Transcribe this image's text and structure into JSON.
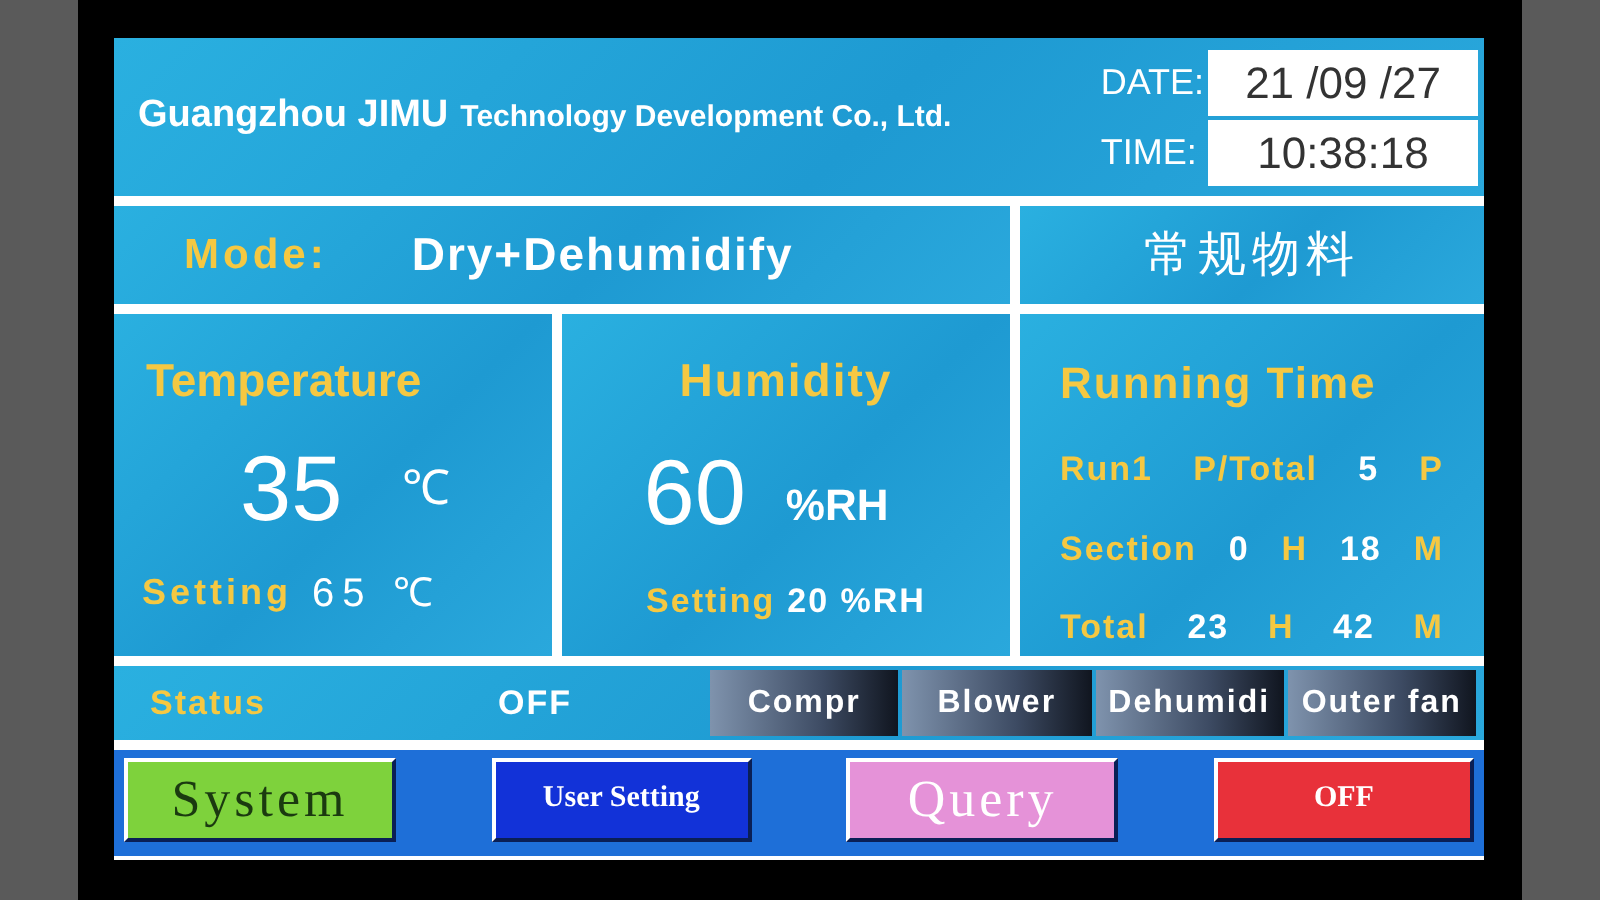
{
  "header": {
    "company_bold": "Guangzhou JIMU",
    "company_rest": "Technology Development Co., Ltd.",
    "date_label": "DATE:",
    "date": "21 /09 /27",
    "time_label": "TIME:",
    "time": "10:38:18"
  },
  "mode": {
    "label": "Mode:",
    "value": "Dry+Dehumidify",
    "material": "常规物料"
  },
  "temperature": {
    "title": "Temperature",
    "value": "35",
    "unit": "℃",
    "setting_label": "Setting",
    "setting_value": "65",
    "setting_unit": "℃"
  },
  "humidity": {
    "title": "Humidity",
    "value": "60",
    "unit": "%RH",
    "setting_label": "Setting",
    "setting_value": "20 %RH"
  },
  "running_time": {
    "title": "Running Time",
    "rows": [
      {
        "parts": [
          {
            "text": "Run1",
            "kind": "label"
          },
          {
            "text": "P/Total",
            "kind": "label"
          },
          {
            "text": "5",
            "kind": "value"
          },
          {
            "text": "P",
            "kind": "label"
          }
        ]
      },
      {
        "parts": [
          {
            "text": "Section",
            "kind": "label"
          },
          {
            "text": "0",
            "kind": "value"
          },
          {
            "text": "H",
            "kind": "label"
          },
          {
            "text": "18",
            "kind": "value"
          },
          {
            "text": "M",
            "kind": "label"
          }
        ]
      },
      {
        "parts": [
          {
            "text": "Total",
            "kind": "label"
          },
          {
            "text": "23",
            "kind": "value"
          },
          {
            "text": "H",
            "kind": "label"
          },
          {
            "text": "42",
            "kind": "value"
          },
          {
            "text": "M",
            "kind": "label"
          }
        ]
      }
    ]
  },
  "status": {
    "label": "Status",
    "value": "OFF",
    "indicators": [
      "Compr",
      "Blower",
      "Dehumidi",
      "Outer fan"
    ]
  },
  "buttons": [
    {
      "label": "System",
      "color": "#7ed23c",
      "kind": "large"
    },
    {
      "label": "User Setting",
      "color": "#1232d8",
      "kind": "small"
    },
    {
      "label": "Query",
      "color": "#e592d8",
      "kind": "large"
    },
    {
      "label": "OFF",
      "color": "#e8313a",
      "kind": "small"
    }
  ]
}
